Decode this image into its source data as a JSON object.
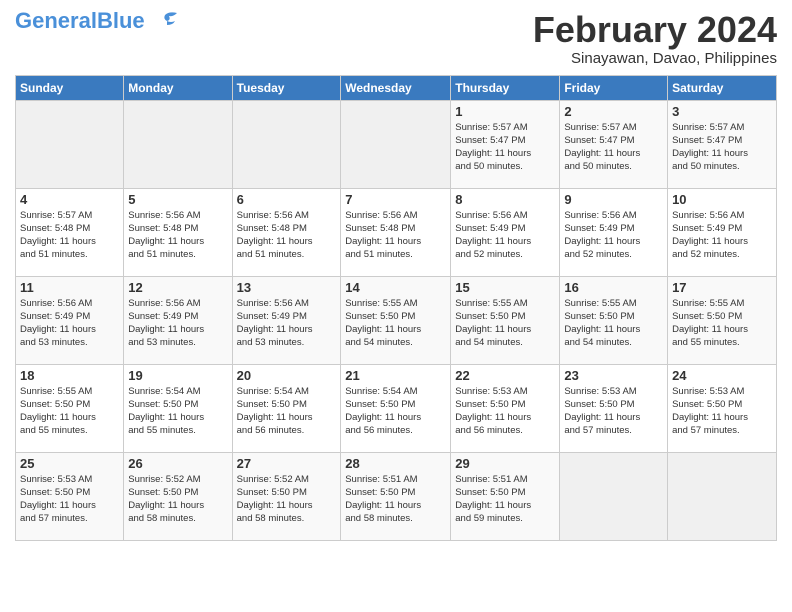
{
  "header": {
    "logo_general": "General",
    "logo_blue": "Blue",
    "month_year": "February 2024",
    "location": "Sinayawan, Davao, Philippines"
  },
  "weekdays": [
    "Sunday",
    "Monday",
    "Tuesday",
    "Wednesday",
    "Thursday",
    "Friday",
    "Saturday"
  ],
  "weeks": [
    [
      {
        "day": "",
        "info": ""
      },
      {
        "day": "",
        "info": ""
      },
      {
        "day": "",
        "info": ""
      },
      {
        "day": "",
        "info": ""
      },
      {
        "day": "1",
        "info": "Sunrise: 5:57 AM\nSunset: 5:47 PM\nDaylight: 11 hours\nand 50 minutes."
      },
      {
        "day": "2",
        "info": "Sunrise: 5:57 AM\nSunset: 5:47 PM\nDaylight: 11 hours\nand 50 minutes."
      },
      {
        "day": "3",
        "info": "Sunrise: 5:57 AM\nSunset: 5:47 PM\nDaylight: 11 hours\nand 50 minutes."
      }
    ],
    [
      {
        "day": "4",
        "info": "Sunrise: 5:57 AM\nSunset: 5:48 PM\nDaylight: 11 hours\nand 51 minutes."
      },
      {
        "day": "5",
        "info": "Sunrise: 5:56 AM\nSunset: 5:48 PM\nDaylight: 11 hours\nand 51 minutes."
      },
      {
        "day": "6",
        "info": "Sunrise: 5:56 AM\nSunset: 5:48 PM\nDaylight: 11 hours\nand 51 minutes."
      },
      {
        "day": "7",
        "info": "Sunrise: 5:56 AM\nSunset: 5:48 PM\nDaylight: 11 hours\nand 51 minutes."
      },
      {
        "day": "8",
        "info": "Sunrise: 5:56 AM\nSunset: 5:49 PM\nDaylight: 11 hours\nand 52 minutes."
      },
      {
        "day": "9",
        "info": "Sunrise: 5:56 AM\nSunset: 5:49 PM\nDaylight: 11 hours\nand 52 minutes."
      },
      {
        "day": "10",
        "info": "Sunrise: 5:56 AM\nSunset: 5:49 PM\nDaylight: 11 hours\nand 52 minutes."
      }
    ],
    [
      {
        "day": "11",
        "info": "Sunrise: 5:56 AM\nSunset: 5:49 PM\nDaylight: 11 hours\nand 53 minutes."
      },
      {
        "day": "12",
        "info": "Sunrise: 5:56 AM\nSunset: 5:49 PM\nDaylight: 11 hours\nand 53 minutes."
      },
      {
        "day": "13",
        "info": "Sunrise: 5:56 AM\nSunset: 5:49 PM\nDaylight: 11 hours\nand 53 minutes."
      },
      {
        "day": "14",
        "info": "Sunrise: 5:55 AM\nSunset: 5:50 PM\nDaylight: 11 hours\nand 54 minutes."
      },
      {
        "day": "15",
        "info": "Sunrise: 5:55 AM\nSunset: 5:50 PM\nDaylight: 11 hours\nand 54 minutes."
      },
      {
        "day": "16",
        "info": "Sunrise: 5:55 AM\nSunset: 5:50 PM\nDaylight: 11 hours\nand 54 minutes."
      },
      {
        "day": "17",
        "info": "Sunrise: 5:55 AM\nSunset: 5:50 PM\nDaylight: 11 hours\nand 55 minutes."
      }
    ],
    [
      {
        "day": "18",
        "info": "Sunrise: 5:55 AM\nSunset: 5:50 PM\nDaylight: 11 hours\nand 55 minutes."
      },
      {
        "day": "19",
        "info": "Sunrise: 5:54 AM\nSunset: 5:50 PM\nDaylight: 11 hours\nand 55 minutes."
      },
      {
        "day": "20",
        "info": "Sunrise: 5:54 AM\nSunset: 5:50 PM\nDaylight: 11 hours\nand 56 minutes."
      },
      {
        "day": "21",
        "info": "Sunrise: 5:54 AM\nSunset: 5:50 PM\nDaylight: 11 hours\nand 56 minutes."
      },
      {
        "day": "22",
        "info": "Sunrise: 5:53 AM\nSunset: 5:50 PM\nDaylight: 11 hours\nand 56 minutes."
      },
      {
        "day": "23",
        "info": "Sunrise: 5:53 AM\nSunset: 5:50 PM\nDaylight: 11 hours\nand 57 minutes."
      },
      {
        "day": "24",
        "info": "Sunrise: 5:53 AM\nSunset: 5:50 PM\nDaylight: 11 hours\nand 57 minutes."
      }
    ],
    [
      {
        "day": "25",
        "info": "Sunrise: 5:53 AM\nSunset: 5:50 PM\nDaylight: 11 hours\nand 57 minutes."
      },
      {
        "day": "26",
        "info": "Sunrise: 5:52 AM\nSunset: 5:50 PM\nDaylight: 11 hours\nand 58 minutes."
      },
      {
        "day": "27",
        "info": "Sunrise: 5:52 AM\nSunset: 5:50 PM\nDaylight: 11 hours\nand 58 minutes."
      },
      {
        "day": "28",
        "info": "Sunrise: 5:51 AM\nSunset: 5:50 PM\nDaylight: 11 hours\nand 58 minutes."
      },
      {
        "day": "29",
        "info": "Sunrise: 5:51 AM\nSunset: 5:50 PM\nDaylight: 11 hours\nand 59 minutes."
      },
      {
        "day": "",
        "info": ""
      },
      {
        "day": "",
        "info": ""
      }
    ]
  ]
}
